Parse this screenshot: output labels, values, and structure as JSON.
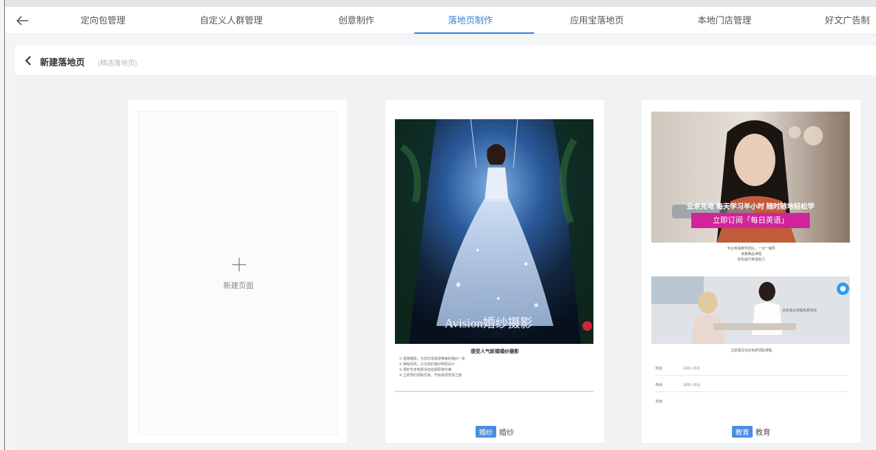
{
  "nav": {
    "tabs": [
      {
        "label": "定向包管理",
        "active": false
      },
      {
        "label": "自定义人群管理",
        "active": false
      },
      {
        "label": "创意制作",
        "active": false
      },
      {
        "label": "落地页制作",
        "active": true
      },
      {
        "label": "应用宝落地页",
        "active": false
      },
      {
        "label": "本地门店管理",
        "active": false
      },
      {
        "label": "好文广告制",
        "active": false
      }
    ]
  },
  "sub": {
    "title": "新建落地页",
    "hint": "(精选落地页)"
  },
  "templates": {
    "new_label": "新建页面",
    "wedding": {
      "tag_badge": "婚纱",
      "tag_label": "婚纱",
      "banner_text": "Avision婚纱摄影",
      "heading": "感受人气新婚婚纱摄影",
      "lines": [
        "① 首席摄影，为您打造浪漫唯美的婚纱一年",
        "② 拥有的风，只为您的婚纱照而设计",
        "③ 限时专享特惠活动名额即将约满",
        "④ 立即预约领取优惠，开启浪漫爱情之旅"
      ]
    },
    "education": {
      "tag_badge": "教育",
      "tag_label": "教育",
      "banner_line1": "业余充电 每天学习半小时 随时随地轻松学",
      "banner_cta": "立即订阅「每日英语」",
      "desc_lines": [
        "专业英语教学团队，一对一辅导",
        "海量精品课程",
        "轻松提升英语能力"
      ],
      "section_title": "全新语言课程免费体验",
      "form_caption": "立即填写信息免费领取课程",
      "form_fields": [
        {
          "label": "姓名",
          "placeholder": "请输入姓名"
        },
        {
          "label": "电话",
          "placeholder": "请输入电话"
        },
        {
          "label": "年级",
          "placeholder": ""
        }
      ]
    }
  },
  "colors": {
    "accent": "#3d7fd6",
    "badge": "#4a8de0",
    "cta": "#d0249a"
  }
}
